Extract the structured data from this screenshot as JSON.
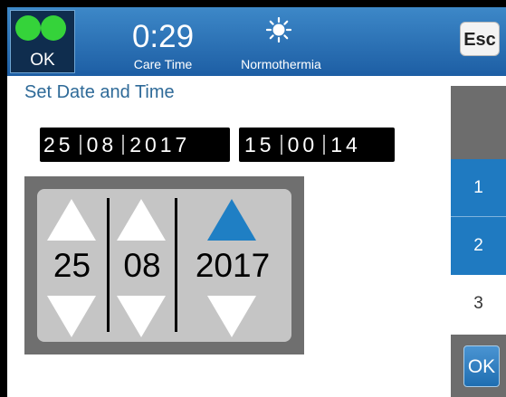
{
  "header": {
    "status_label": "OK",
    "timer": "0:29",
    "timer_label": "Care Time",
    "mode_icon": "sun-icon",
    "mode_label": "Normothermia",
    "esc_label": "Esc",
    "colors": {
      "header": "#2a72b5",
      "led": "#35d33a",
      "status_box": "#0f2d4e"
    }
  },
  "title": "Set Date and Time",
  "date_display": [
    "25",
    "08",
    "2017"
  ],
  "time_display": [
    "15",
    "00",
    "14"
  ],
  "picker": {
    "columns": [
      {
        "value": "25",
        "up_active": false
      },
      {
        "value": "08",
        "up_active": false
      },
      {
        "value": "2017",
        "up_active": true
      }
    ],
    "colors": {
      "active_arrow": "#1f7fc4",
      "arrow": "#ffffff"
    }
  },
  "tabs": [
    {
      "label": "1",
      "selected": false
    },
    {
      "label": "2",
      "selected": false
    },
    {
      "label": "3",
      "selected": true
    }
  ],
  "ok_label": "OK"
}
